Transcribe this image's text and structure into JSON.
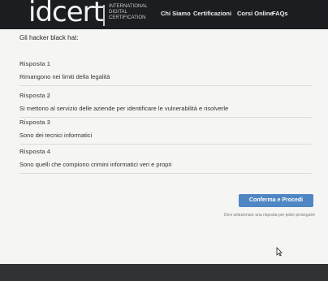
{
  "header": {
    "logo_text": "idcert",
    "logo_sub": [
      "INTERNATIONAL",
      "DIGITAL",
      "CERTIFICATION"
    ],
    "nav": [
      "Chi Siamo",
      "Certificazioni",
      "Corsi Online",
      "FAQs"
    ]
  },
  "question": "Gli hacker black hat:",
  "answers": [
    {
      "title": "Risposta 1",
      "text": "Rimangono nei limiti della legalità"
    },
    {
      "title": "Risposta 2",
      "text": "Si mettono al servizio delle aziende per identificare le vulnerabilità e risolverle"
    },
    {
      "title": "Risposta 3",
      "text": "Sono dei tecnici informatici"
    },
    {
      "title": "Risposta 4",
      "text": "Sono quelli che compiono crimini informatici veri e propri"
    }
  ],
  "confirm_label": "Conferma e Procedi",
  "note": "Devi selezionare una risposta per poter proseguire"
}
